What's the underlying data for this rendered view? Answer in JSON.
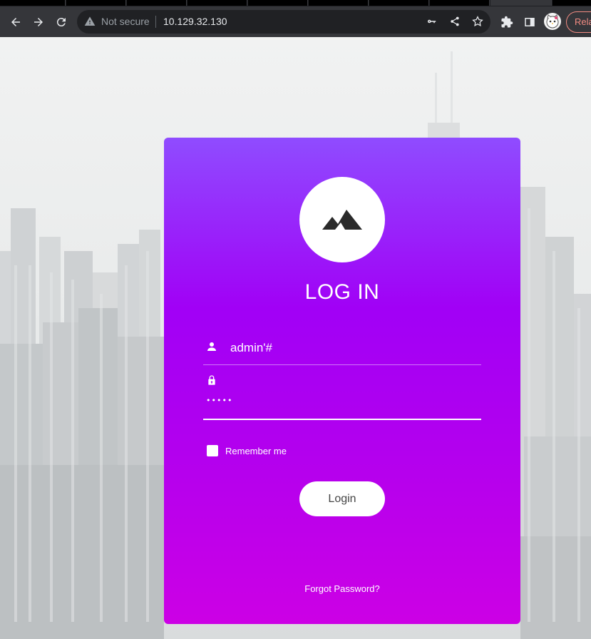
{
  "browser": {
    "security_label": "Not secure",
    "url": "10.129.32.130",
    "relaunch_label": "Rela",
    "icons": {
      "back": "arrow-left-icon",
      "forward": "arrow-right-icon",
      "reload": "reload-icon",
      "warning": "warning-triangle-icon",
      "key": "key-icon",
      "share": "share-icon",
      "bookmark": "star-icon",
      "extensions": "puzzle-icon",
      "side_panel": "side-panel-icon"
    }
  },
  "login": {
    "title": "LOG IN",
    "username_value": "admin'#",
    "password_mask": "•••••",
    "remember_label": "Remember me",
    "login_button": "Login",
    "forgot_link": "Forgot Password?",
    "icons": {
      "logo": "mountain-icon",
      "user": "user-icon",
      "password": "lock-icon"
    },
    "colors": {
      "gradient_top": "#8f4cff",
      "gradient_bottom": "#cc00e5"
    }
  }
}
